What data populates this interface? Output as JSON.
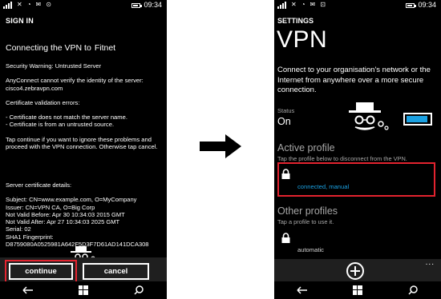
{
  "status_bar": {
    "time": "09:34"
  },
  "left_screen": {
    "title": "SIGN IN",
    "connecting_text": "Connecting the VPN to",
    "profile_name": "Fitnet",
    "warning_title": "Security Warning: Untrusted Server",
    "warning_body_1": "AnyConnect cannot verify the identity of the server:",
    "warning_body_2": "cisco4.zebravpn.com",
    "errors_title": "Certificate validation errors:",
    "errors": [
      "- Certificate does not match the server name.",
      "- Certificate is from an untrusted source."
    ],
    "tap_text": "Tap continue if you want to ignore these problems and proceed with the VPN connection. Otherwise tap cancel.",
    "details_title": "Server certificate details:",
    "details": [
      "Subject: CN=www.example.com, O=MyCompany",
      "Issuer: CN=VPN CA, O=Big Corp",
      "Not Valid Before: Apr 30 10:34:03 2015 GMT",
      "Not Valid After: Apr 27 10:34:03 2025 GMT",
      "Serial: 02",
      "SHA1 Fingerprint:",
      "D8759080A0525981A642F5D3F7D61AD141DCA308"
    ],
    "continue_label": "continue",
    "cancel_label": "cancel"
  },
  "right_screen": {
    "section": "SETTINGS",
    "title": "VPN",
    "description": "Connect to your organisation's network or the Internet from anywhere over a more secure connection.",
    "status_label": "Status",
    "status_value": "On",
    "toggle_on": true,
    "active_header": "Active profile",
    "active_hint": "Tap the profile below to disconnect from the VPN.",
    "active_profile_status": "connected, manual",
    "other_header": "Other profiles",
    "other_hint": "Tap a profile to use it.",
    "other_profile_name": "automatic",
    "more_label": "..."
  },
  "colors": {
    "accent": "#1ba1e2",
    "highlight": "#e3232f",
    "background": "#000000",
    "appbar": "#1f1f1f"
  },
  "icons": [
    "signal-icon",
    "wifi-icon",
    "battery-icon",
    "lock-icon",
    "add-icon",
    "back-icon",
    "windows-start-icon",
    "search-icon",
    "spy-mascot-icon",
    "arrow-right-icon"
  ]
}
